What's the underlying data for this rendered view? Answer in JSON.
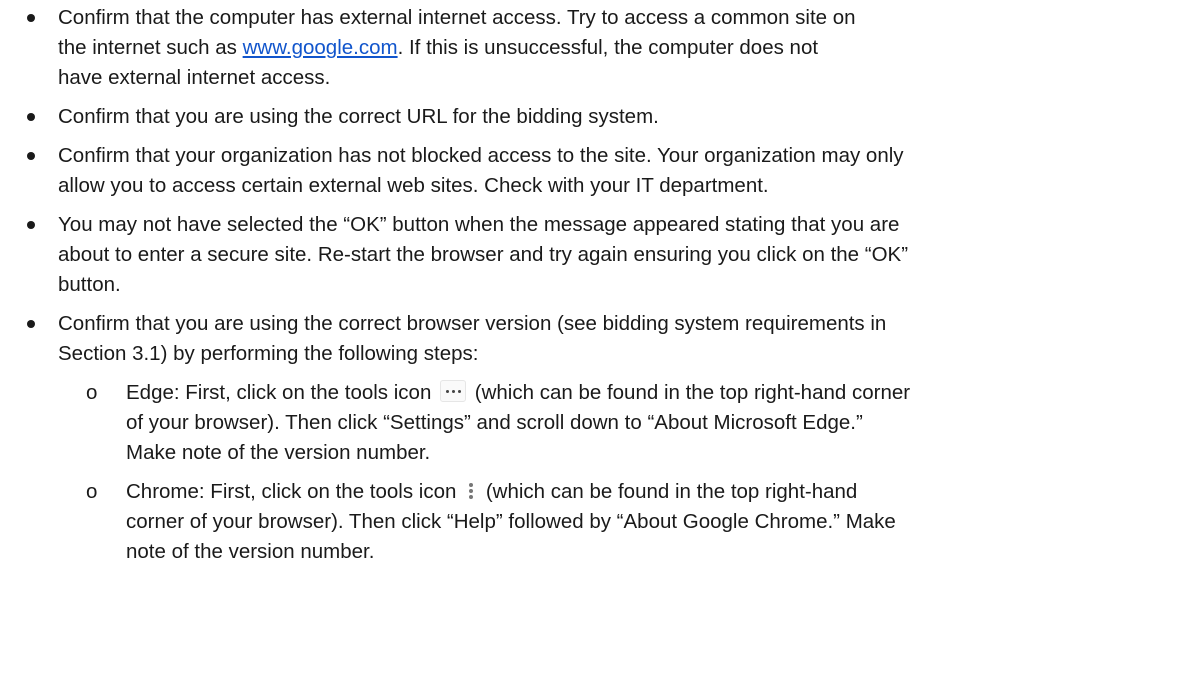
{
  "bullets": [
    {
      "line1": "Confirm that the computer has external internet access.  Try to access a common site on",
      "line2_before": "the internet such as ",
      "link_text": "www.google.com",
      "line2_after": ".  If this is unsuccessful, the computer does not",
      "line3": "have external internet access."
    },
    {
      "text": "Confirm that you are using the correct URL for the bidding system."
    },
    {
      "line1": "Confirm that your organization has not blocked access to the site.  Your organization may only",
      "line2": "allow you to access certain external web sites.  Check with your IT department."
    },
    {
      "line1": "You may not have selected the “OK” button when the message appeared stating that you are",
      "line2": "about to enter a secure site.  Re-start the browser and try again ensuring you click on the “OK”",
      "line3": "button."
    },
    {
      "line1": "Confirm that you are using the correct browser version (see bidding system requirements in",
      "line2": "Section 3.1) by performing the following steps:"
    }
  ],
  "sub_marker": "o",
  "sub_items": [
    {
      "line1_before": "Edge: First, click on the tools icon",
      "line1_after": "(which can be found in the top right-hand corner",
      "line2": "of your browser). Then click “Settings” and scroll down to “About Microsoft Edge.”",
      "line3": "Make note of the version number."
    },
    {
      "line1_before": "Chrome:  First, click on the tools icon",
      "line1_after": "(which can be found in the top right-hand",
      "line2": "corner of your browser).  Then click “Help” followed by “About Google Chrome.”  Make",
      "line3": "note of the version number."
    }
  ]
}
